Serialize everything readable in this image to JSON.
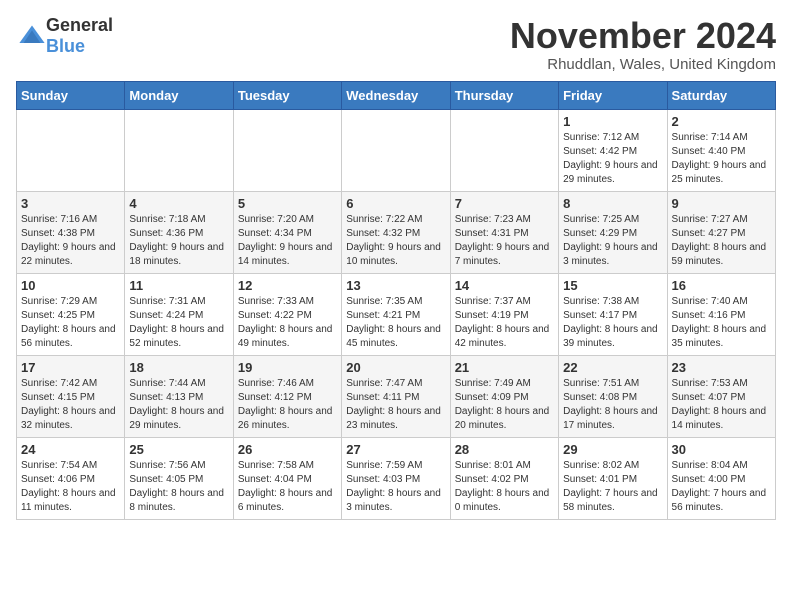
{
  "logo": {
    "general": "General",
    "blue": "Blue"
  },
  "title": {
    "month": "November 2024",
    "location": "Rhuddlan, Wales, United Kingdom"
  },
  "days_of_week": [
    "Sunday",
    "Monday",
    "Tuesday",
    "Wednesday",
    "Thursday",
    "Friday",
    "Saturday"
  ],
  "weeks": [
    [
      {
        "day": "",
        "info": ""
      },
      {
        "day": "",
        "info": ""
      },
      {
        "day": "",
        "info": ""
      },
      {
        "day": "",
        "info": ""
      },
      {
        "day": "",
        "info": ""
      },
      {
        "day": "1",
        "info": "Sunrise: 7:12 AM\nSunset: 4:42 PM\nDaylight: 9 hours and 29 minutes."
      },
      {
        "day": "2",
        "info": "Sunrise: 7:14 AM\nSunset: 4:40 PM\nDaylight: 9 hours and 25 minutes."
      }
    ],
    [
      {
        "day": "3",
        "info": "Sunrise: 7:16 AM\nSunset: 4:38 PM\nDaylight: 9 hours and 22 minutes."
      },
      {
        "day": "4",
        "info": "Sunrise: 7:18 AM\nSunset: 4:36 PM\nDaylight: 9 hours and 18 minutes."
      },
      {
        "day": "5",
        "info": "Sunrise: 7:20 AM\nSunset: 4:34 PM\nDaylight: 9 hours and 14 minutes."
      },
      {
        "day": "6",
        "info": "Sunrise: 7:22 AM\nSunset: 4:32 PM\nDaylight: 9 hours and 10 minutes."
      },
      {
        "day": "7",
        "info": "Sunrise: 7:23 AM\nSunset: 4:31 PM\nDaylight: 9 hours and 7 minutes."
      },
      {
        "day": "8",
        "info": "Sunrise: 7:25 AM\nSunset: 4:29 PM\nDaylight: 9 hours and 3 minutes."
      },
      {
        "day": "9",
        "info": "Sunrise: 7:27 AM\nSunset: 4:27 PM\nDaylight: 8 hours and 59 minutes."
      }
    ],
    [
      {
        "day": "10",
        "info": "Sunrise: 7:29 AM\nSunset: 4:25 PM\nDaylight: 8 hours and 56 minutes."
      },
      {
        "day": "11",
        "info": "Sunrise: 7:31 AM\nSunset: 4:24 PM\nDaylight: 8 hours and 52 minutes."
      },
      {
        "day": "12",
        "info": "Sunrise: 7:33 AM\nSunset: 4:22 PM\nDaylight: 8 hours and 49 minutes."
      },
      {
        "day": "13",
        "info": "Sunrise: 7:35 AM\nSunset: 4:21 PM\nDaylight: 8 hours and 45 minutes."
      },
      {
        "day": "14",
        "info": "Sunrise: 7:37 AM\nSunset: 4:19 PM\nDaylight: 8 hours and 42 minutes."
      },
      {
        "day": "15",
        "info": "Sunrise: 7:38 AM\nSunset: 4:17 PM\nDaylight: 8 hours and 39 minutes."
      },
      {
        "day": "16",
        "info": "Sunrise: 7:40 AM\nSunset: 4:16 PM\nDaylight: 8 hours and 35 minutes."
      }
    ],
    [
      {
        "day": "17",
        "info": "Sunrise: 7:42 AM\nSunset: 4:15 PM\nDaylight: 8 hours and 32 minutes."
      },
      {
        "day": "18",
        "info": "Sunrise: 7:44 AM\nSunset: 4:13 PM\nDaylight: 8 hours and 29 minutes."
      },
      {
        "day": "19",
        "info": "Sunrise: 7:46 AM\nSunset: 4:12 PM\nDaylight: 8 hours and 26 minutes."
      },
      {
        "day": "20",
        "info": "Sunrise: 7:47 AM\nSunset: 4:11 PM\nDaylight: 8 hours and 23 minutes."
      },
      {
        "day": "21",
        "info": "Sunrise: 7:49 AM\nSunset: 4:09 PM\nDaylight: 8 hours and 20 minutes."
      },
      {
        "day": "22",
        "info": "Sunrise: 7:51 AM\nSunset: 4:08 PM\nDaylight: 8 hours and 17 minutes."
      },
      {
        "day": "23",
        "info": "Sunrise: 7:53 AM\nSunset: 4:07 PM\nDaylight: 8 hours and 14 minutes."
      }
    ],
    [
      {
        "day": "24",
        "info": "Sunrise: 7:54 AM\nSunset: 4:06 PM\nDaylight: 8 hours and 11 minutes."
      },
      {
        "day": "25",
        "info": "Sunrise: 7:56 AM\nSunset: 4:05 PM\nDaylight: 8 hours and 8 minutes."
      },
      {
        "day": "26",
        "info": "Sunrise: 7:58 AM\nSunset: 4:04 PM\nDaylight: 8 hours and 6 minutes."
      },
      {
        "day": "27",
        "info": "Sunrise: 7:59 AM\nSunset: 4:03 PM\nDaylight: 8 hours and 3 minutes."
      },
      {
        "day": "28",
        "info": "Sunrise: 8:01 AM\nSunset: 4:02 PM\nDaylight: 8 hours and 0 minutes."
      },
      {
        "day": "29",
        "info": "Sunrise: 8:02 AM\nSunset: 4:01 PM\nDaylight: 7 hours and 58 minutes."
      },
      {
        "day": "30",
        "info": "Sunrise: 8:04 AM\nSunset: 4:00 PM\nDaylight: 7 hours and 56 minutes."
      }
    ]
  ]
}
